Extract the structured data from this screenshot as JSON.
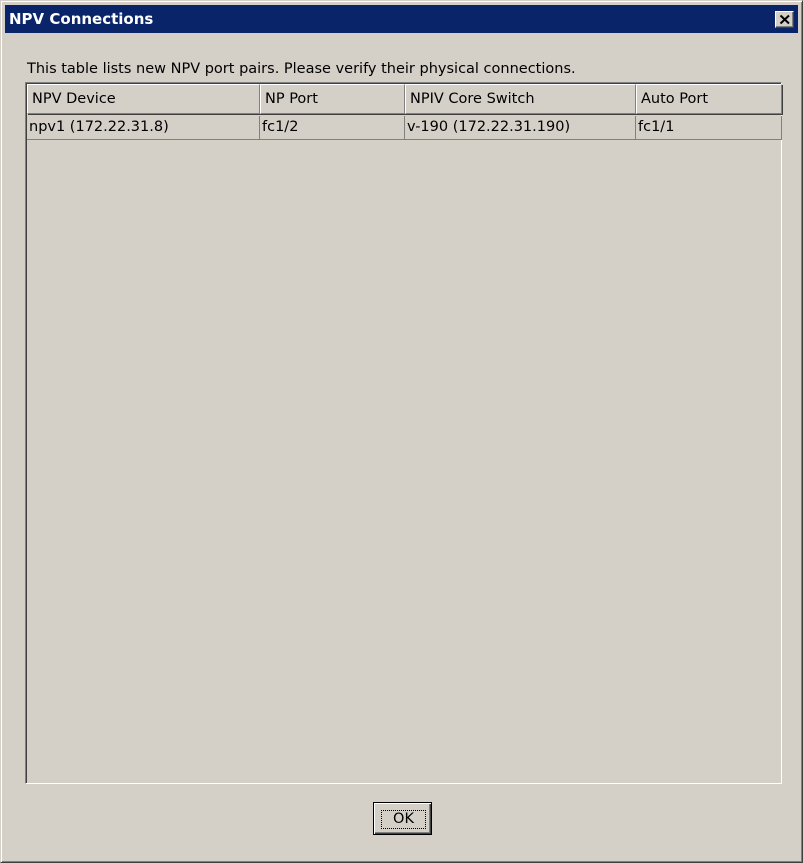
{
  "window": {
    "title": "NPV Connections"
  },
  "description": "This table lists new NPV port pairs. Please verify their physical connections.",
  "table": {
    "columns": [
      "NPV Device",
      "NP Port",
      "NPIV Core Switch",
      "Auto Port"
    ],
    "rows": [
      [
        "npv1 (172.22.31.8)",
        "fc1/2",
        "v-190 (172.22.31.190)",
        "fc1/1"
      ]
    ]
  },
  "buttons": {
    "ok_label": "OK"
  },
  "icons": {
    "close": "close-icon"
  },
  "colors": {
    "titlebar": "#0a246a",
    "face": "#d4d0c8"
  }
}
